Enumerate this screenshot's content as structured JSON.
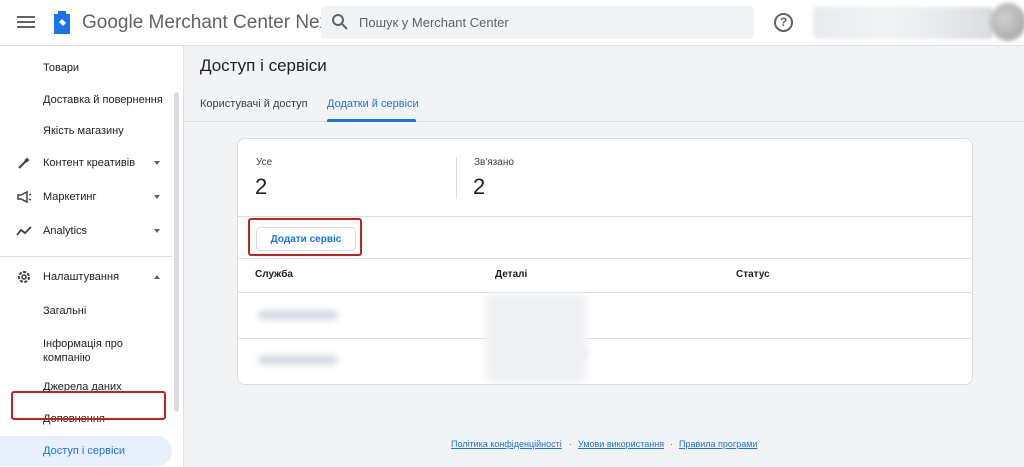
{
  "header": {
    "app_title": "Google Merchant Center Next",
    "search_placeholder": "Пошук у Merchant Center",
    "help_icon": "?"
  },
  "sidebar": {
    "items": [
      {
        "label": "Товари"
      },
      {
        "label": "Доставка й повернення"
      },
      {
        "label": "Якість магазину"
      },
      {
        "label": "Контент креативів",
        "icon": "creative-icon"
      },
      {
        "label": "Маркетинг",
        "icon": "megaphone-icon"
      },
      {
        "label": "Analytics",
        "icon": "trend-icon"
      },
      {
        "label": "Налаштування",
        "icon": "gear-icon"
      },
      {
        "label": "Загальні"
      },
      {
        "label": "Інформація про компанію"
      },
      {
        "label": "Джерела даних"
      },
      {
        "label": "Доповнення"
      },
      {
        "label": "Доступ і сервіси"
      }
    ]
  },
  "main": {
    "title": "Доступ і сервіси",
    "tabs": [
      {
        "label": "Користувачі й доступ"
      },
      {
        "label": "Додатки й сервіси"
      }
    ],
    "stats": {
      "all_label": "Усе",
      "all_value": "2",
      "linked_label": "Зв'язано",
      "linked_value": "2"
    },
    "add_button": "Додати сервіс",
    "table": {
      "headers": [
        "Служба",
        "Деталі",
        "Статус"
      ]
    }
  },
  "footer": {
    "links": [
      "Політика конфіденційності",
      "Умови використання",
      "Правила програми"
    ],
    "separator": "·"
  },
  "colors": {
    "accent": "#1a73e8",
    "highlight": "#c5221f"
  }
}
